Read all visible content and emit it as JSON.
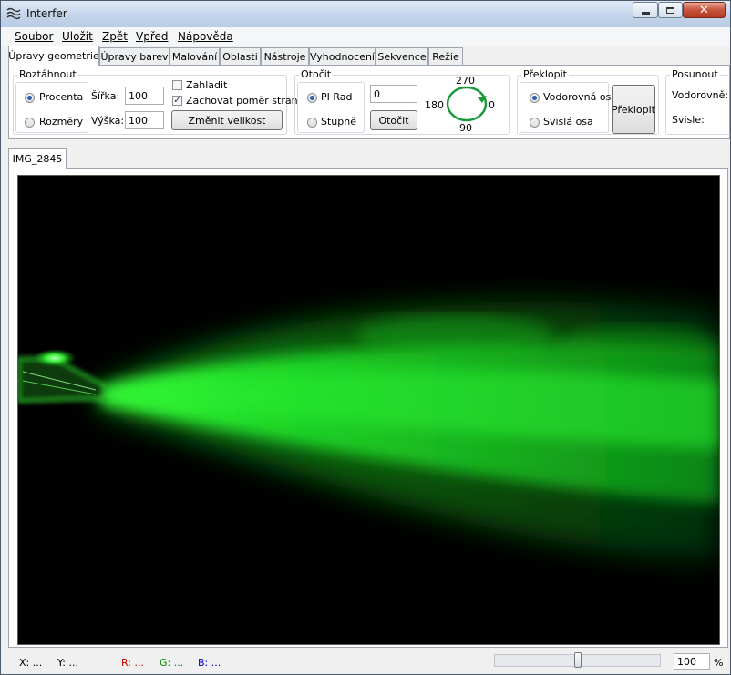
{
  "window": {
    "title": "Interfer"
  },
  "menu": [
    "Soubor",
    "Uložit",
    "Zpět",
    "Vpřed",
    "Nápověda"
  ],
  "tabs": [
    "Úpravy geometrie",
    "Úpravy barev",
    "Malování",
    "Oblasti",
    "Nástroje",
    "Vyhodnocení",
    "Sekvence",
    "Režie"
  ],
  "active_tab": "Úpravy geometrie",
  "resize": {
    "label": "Roztáhnout",
    "mode_percent": "Procenta",
    "mode_size": "Rozměry",
    "mode_selected": "Procenta",
    "width_label": "Šířka:",
    "width_value": "100",
    "height_label": "Výška:",
    "height_value": "100",
    "smooth_label": "Zahladit",
    "smooth_checked": false,
    "keep_ratio_label": "Zachovat poměr stran",
    "keep_ratio_checked": true,
    "apply_button": "Změnit velikost"
  },
  "rotate": {
    "label": "Otočit",
    "unit_pi": "PI Rad",
    "unit_deg": "Stupně",
    "unit_selected": "PI Rad",
    "angle_value": "0",
    "apply_button": "Otočit",
    "dial_labels": {
      "top": "270",
      "left": "180",
      "right": "0",
      "bottom": "90"
    },
    "dial_color": "#1a9a3a"
  },
  "flip": {
    "label": "Překlopit",
    "horizontal": "Vodorovná osa",
    "vertical": "Svislá osa",
    "selected": "Vodorovná osa",
    "apply_button": "Překlopit"
  },
  "shift": {
    "label": "Posunout",
    "horizontal_label": "Vodorovně:",
    "vertical_label": "Svisle:"
  },
  "document": {
    "tab": "IMG_2845"
  },
  "status": {
    "x": "X: ...",
    "y": "Y: ...",
    "r": "R: ...",
    "g": "G: ...",
    "b": "B: ...",
    "r_color": "#c00000",
    "g_color": "#008000",
    "b_color": "#0000c0",
    "zoom_value": "100",
    "zoom_unit": "%",
    "zoom_fraction": 0.5
  },
  "colors": {
    "laser_green": "#1fd62a"
  }
}
